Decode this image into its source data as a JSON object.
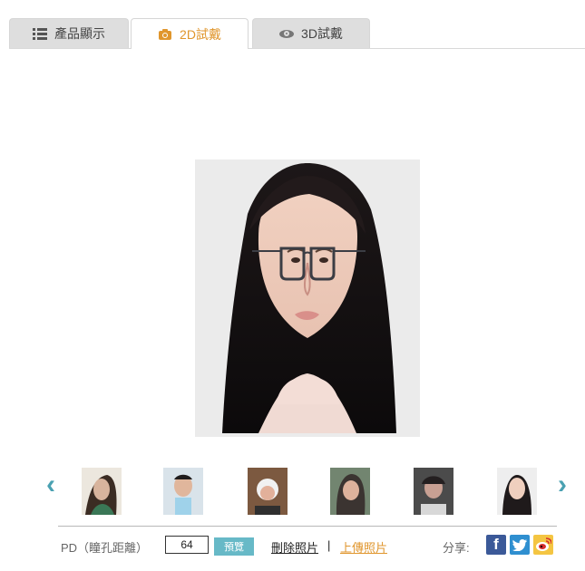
{
  "tabs": {
    "products": {
      "label": "產品顯示",
      "icon": "list-icon"
    },
    "two_d": {
      "label": "2D試戴",
      "icon": "camera-icon",
      "active": true
    },
    "three_d": {
      "label": "3D試戴",
      "icon": "eye-icon"
    }
  },
  "preview": {
    "subject": "woman wearing black rectangular glasses"
  },
  "thumbnails": [
    {
      "name": "thumb-1"
    },
    {
      "name": "thumb-2"
    },
    {
      "name": "thumb-3"
    },
    {
      "name": "thumb-4"
    },
    {
      "name": "thumb-5"
    },
    {
      "name": "thumb-6"
    }
  ],
  "controls": {
    "pd_label": "PD（瞳孔距離）",
    "pd_value": "64",
    "preview_label": "預覽",
    "delete_label": "刪除照片",
    "separator": "|",
    "upload_label": "上傳照片",
    "share_label": "分享:"
  },
  "icons": {
    "left_arrow": "‹",
    "right_arrow": "›",
    "facebook": "f",
    "twitter": "t",
    "weibo": "weibo-icon"
  },
  "colors": {
    "accent": "#e0962d",
    "teal": "#67b9c7",
    "facebook": "#3b5998",
    "twitter": "#2f8fd0",
    "weibo": "#f4c542"
  }
}
